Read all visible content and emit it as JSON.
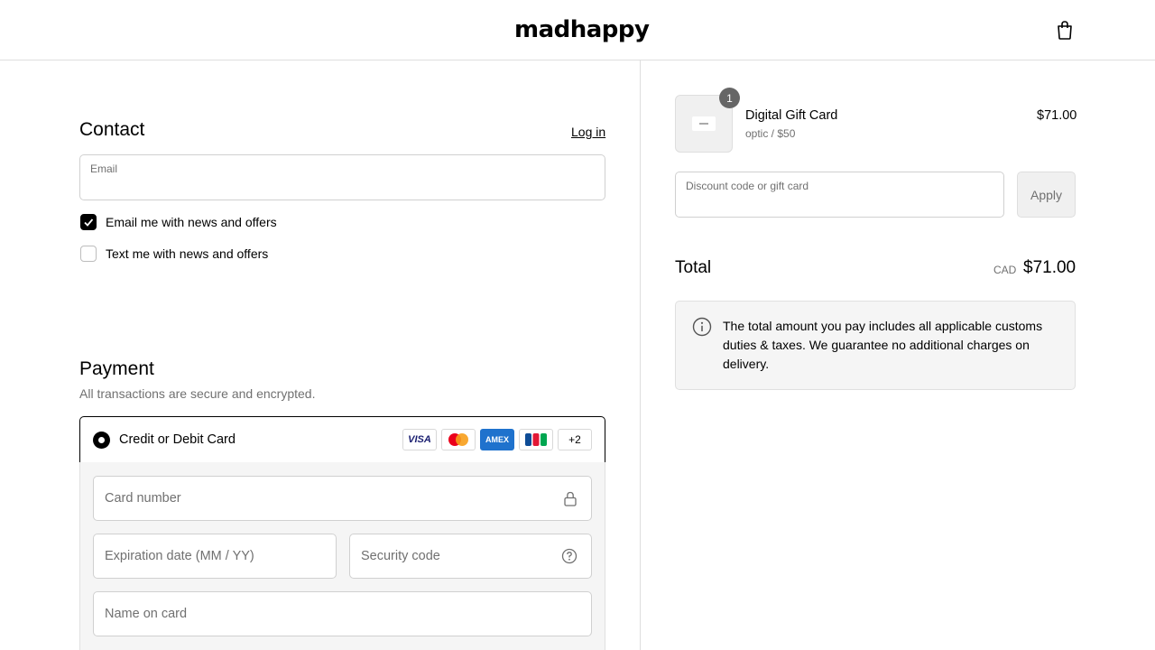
{
  "header": {
    "logo": "madhappy",
    "cart_icon": "shopping-bag-icon"
  },
  "contact": {
    "title": "Contact",
    "login": "Log in",
    "email_label": "Email",
    "email_value": "",
    "news_email": {
      "label": "Email me with news and offers",
      "checked": true
    },
    "news_text": {
      "label": "Text me with news and offers",
      "checked": false
    }
  },
  "payment": {
    "title": "Payment",
    "subtitle": "All transactions are secure and encrypted.",
    "method": "Credit or Debit Card",
    "brands": [
      "VISA",
      "mastercard",
      "AMEX",
      "JCB"
    ],
    "more_brands": "+2",
    "card_number": "Card number",
    "expiration": "Expiration date (MM / YY)",
    "security": "Security code",
    "name_on_card": "Name on card"
  },
  "summary": {
    "item": {
      "name": "Digital Gift Card",
      "variant": "optic / $50",
      "price": "$71.00",
      "quantity": "1"
    },
    "discount_placeholder": "Discount code or gift card",
    "apply": "Apply",
    "total_label": "Total",
    "currency": "CAD",
    "total": "$71.00",
    "notice": "The total amount you pay includes all applicable customs duties & taxes. We guarantee no additional charges on delivery."
  }
}
